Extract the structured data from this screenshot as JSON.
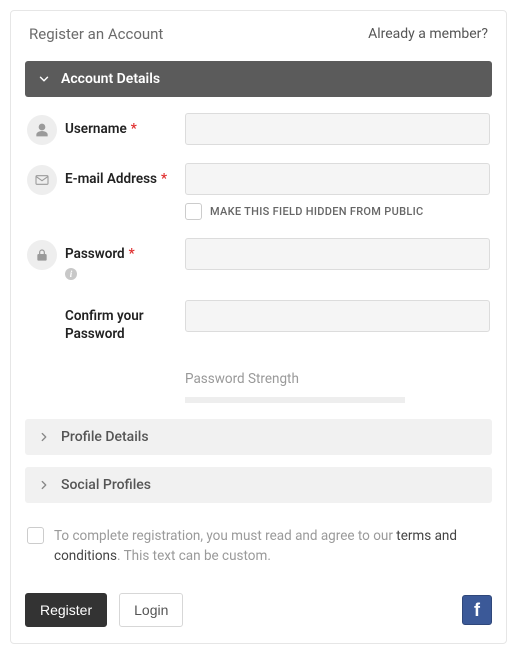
{
  "header": {
    "title": "Register an Account",
    "already": "Already a member?"
  },
  "sections": {
    "account": "Account Details",
    "profile": "Profile Details",
    "social": "Social Profiles"
  },
  "fields": {
    "username": {
      "label": "Username",
      "required": "*"
    },
    "email": {
      "label": "E-mail Address",
      "required": "*",
      "hide_label": "MAKE THIS FIELD HIDDEN FROM PUBLIC"
    },
    "password": {
      "label": "Password",
      "required": "*"
    },
    "confirm": {
      "label": "Confirm your Password"
    },
    "strength": {
      "label": "Password Strength"
    }
  },
  "terms": {
    "pre": "To complete registration, you must read and agree to our ",
    "link": "terms and conditions",
    "post": ". This text can be custom."
  },
  "buttons": {
    "register": "Register",
    "login": "Login"
  }
}
